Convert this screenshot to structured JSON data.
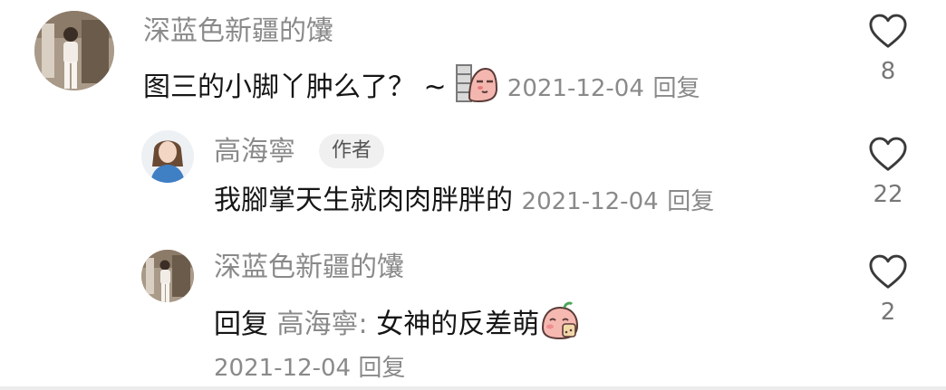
{
  "comments": [
    {
      "username": "深蓝色新疆的馕",
      "text": "图三的小脚丫肿么了？ ~",
      "emoji": "peeking-peach-emoji",
      "date": "2021-12-04",
      "reply_label": "回复",
      "likes": "8"
    },
    {
      "username": "高海寧",
      "author_tag": "作者",
      "text": "我腳掌天生就肉肉胖胖的",
      "date": "2021-12-04",
      "reply_label": "回复",
      "likes": "22"
    },
    {
      "username": "深蓝色新疆的馕",
      "reply_prefix": "回复",
      "mention": "高海寧:",
      "text": "女神的反差萌",
      "emoji": "shy-peach-emoji",
      "date": "2021-12-04",
      "reply_label": "回复",
      "likes": "2"
    }
  ],
  "icons": {
    "like": "heart-outline-icon"
  },
  "colors": {
    "secondary_text": "#8a8a8a",
    "primary_text": "#161616",
    "author_tag_bg": "#f0f0f0"
  }
}
